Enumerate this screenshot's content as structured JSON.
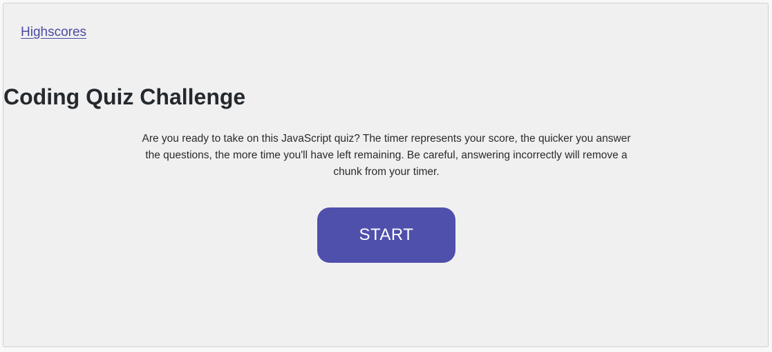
{
  "header": {
    "highscores_link": "Highscores"
  },
  "main": {
    "title": "Coding Quiz Challenge",
    "description": "Are you ready to take on this JavaScript quiz? The timer represents your score, the quicker you answer the questions, the more time you'll have left remaining. Be careful, answering incorrectly will remove a chunk from your timer.",
    "start_button": "START"
  },
  "colors": {
    "accent": "#4f4fac",
    "link": "#4a4aa6",
    "panel_background": "#f0f0f0"
  }
}
